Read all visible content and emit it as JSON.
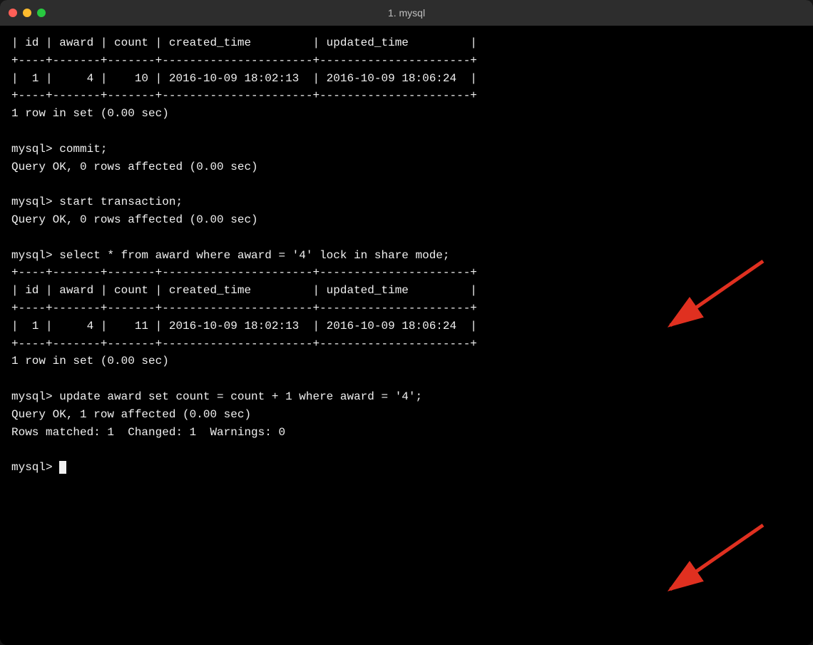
{
  "window": {
    "title": "1. mysql",
    "traffic_lights": [
      "close",
      "minimize",
      "maximize"
    ]
  },
  "terminal": {
    "lines": [
      "| id | award | count | created_time         | updated_time         |",
      "+----+-------+-------+----------------------+----------------------+",
      "|  1 |     4 |    10 | 2016-10-09 18:02:13  | 2016-10-09 18:06:24  |",
      "+----+-------+-------+----------------------+----------------------+",
      "1 row in set (0.00 sec)",
      "",
      "mysql> commit;",
      "Query OK, 0 rows affected (0.00 sec)",
      "",
      "mysql> start transaction;",
      "Query OK, 0 rows affected (0.00 sec)",
      "",
      "mysql> select * from award where award = '4' lock in share mode;",
      "+----+-------+-------+----------------------+----------------------+",
      "| id | award | count | created_time         | updated_time         |",
      "+----+-------+-------+----------------------+----------------------+",
      "|  1 |     4 |    11 | 2016-10-09 18:02:13  | 2016-10-09 18:06:24  |",
      "+----+-------+-------+----------------------+----------------------+",
      "1 row in set (0.00 sec)",
      "",
      "mysql> update award set count = count + 1 where award = '4';",
      "Query OK, 1 row affected (0.00 sec)",
      "Rows matched: 1  Changed: 1  Warnings: 0",
      "",
      "mysql> "
    ],
    "last_line_cursor": true
  },
  "arrows": [
    {
      "id": "arrow1",
      "position": "top-right",
      "direction": "down-left"
    },
    {
      "id": "arrow2",
      "position": "bottom-right",
      "direction": "down-left"
    }
  ]
}
